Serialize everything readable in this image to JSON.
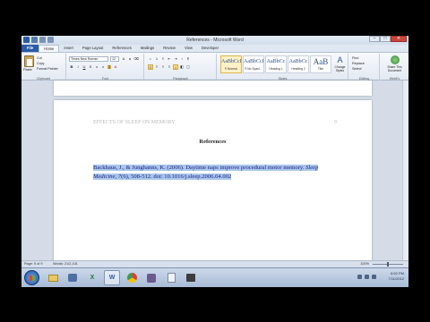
{
  "window": {
    "title": "References - Microsoft Word",
    "buttons": [
      "–",
      "□",
      "✕"
    ]
  },
  "ribbon": {
    "tabs": [
      "File",
      "Home",
      "Insert",
      "Page Layout",
      "References",
      "Mailings",
      "Review",
      "View",
      "Developer"
    ],
    "active_tab": "Home",
    "clipboard": {
      "paste": "Paste",
      "cut": "Cut",
      "copy": "Copy",
      "format_painter": "Format Painter",
      "label": "Clipboard"
    },
    "font": {
      "name": "Times New Roman",
      "size": "12",
      "label": "Font"
    },
    "paragraph": {
      "label": "Paragraph"
    },
    "styles": {
      "items": [
        {
          "sample": "AaBbCcI",
          "name": "¶ Normal"
        },
        {
          "sample": "AaBbCcI",
          "name": "¶ No Spaci..."
        },
        {
          "sample": "AaBbCc",
          "name": "Heading 1"
        },
        {
          "sample": "AaBbCc",
          "name": "Heading 2"
        },
        {
          "sample": "AaB",
          "name": "Title"
        }
      ],
      "change_styles": "Change Styles",
      "label": "Styles"
    },
    "editing": {
      "find": "Find",
      "replace": "Replace",
      "select": "Select",
      "label": "Editing"
    },
    "share": {
      "share_webex": "Share This Document",
      "label": "WebEx"
    }
  },
  "document": {
    "header_text": "EFFECTS OF SLEEP ON MEMORY",
    "page_number": "9",
    "title": "References",
    "reference": {
      "authors": "Backhaus, J., & Junghanns, K. (2006). Daytime naps improve procedural motor memory. ",
      "journal": "Sleep Medicine, 7",
      "details": "(6), 508-512. ",
      "doi": "doi: 10.1016/j.sleep.2006.04.002"
    }
  },
  "statusbar": {
    "page": "Page: 9 of 9",
    "words": "Words: 21/2,101",
    "zoom": "100%"
  },
  "taskbar": {
    "time": "8:52 PM",
    "date": "7/11/2012"
  }
}
